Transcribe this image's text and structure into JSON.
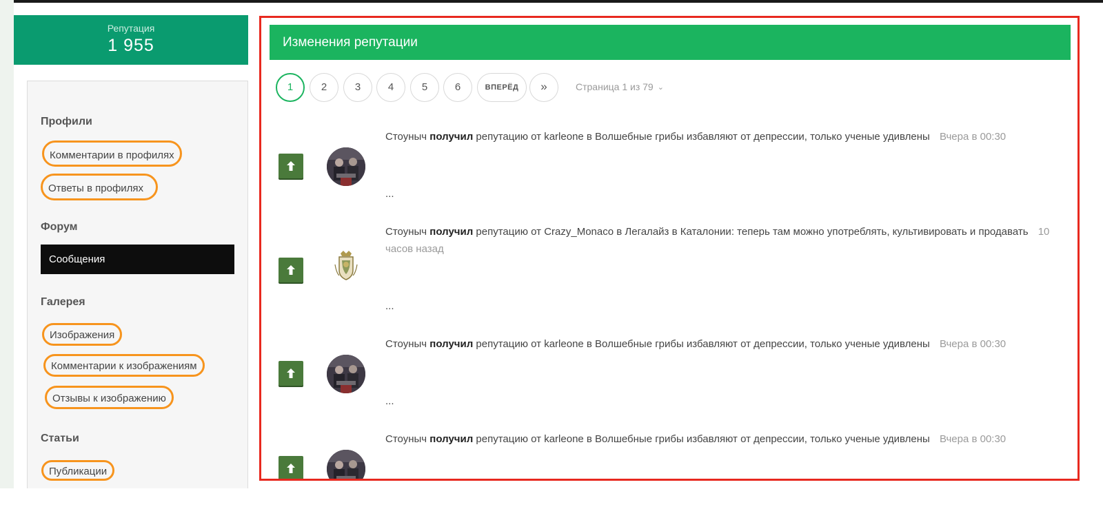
{
  "reputation": {
    "label": "Репутация",
    "value": "1 955"
  },
  "sidebar": {
    "sections": [
      {
        "heading": "Профили"
      },
      {
        "heading": "Форум"
      },
      {
        "heading": "Галерея"
      },
      {
        "heading": "Статьи"
      }
    ],
    "links": {
      "profile_comments": "Комментарии в профилях",
      "profile_replies": "Ответы в профилях",
      "forum_posts": "Сообщения",
      "gallery_images": "Изображения",
      "gallery_image_comments": "Комментарии к изображениям",
      "gallery_image_reviews": "Отзывы к изображению",
      "articles_publications": "Публикации"
    }
  },
  "main": {
    "title": "Изменения репутации",
    "pager": {
      "pages": [
        "1",
        "2",
        "3",
        "4",
        "5",
        "6"
      ],
      "current": "1",
      "next_label": "ВПЕРЁД",
      "last_label": "»",
      "info": "Страница 1 из 79"
    },
    "feed": [
      {
        "user": "Стоуныч",
        "action": "получил",
        "text": "репутацию от karleone в Волшебные грибы избавляют от депрессии, только ученые удивлены",
        "time": "Вчера в 00:30",
        "excerpt": "...",
        "avatar": "avatar-photo"
      },
      {
        "user": "Стоуныч",
        "action": "получил",
        "text": "репутацию от Crazy_Monaco в Легалайз в Каталонии: теперь там можно употреблять, культивировать и продавать",
        "time": "10 часов назад",
        "excerpt": "...",
        "avatar": "monaco-crest"
      },
      {
        "user": "Стоуныч",
        "action": "получил",
        "text": "репутацию от karleone в Волшебные грибы избавляют от депрессии, только ученые удивлены",
        "time": "Вчера в 00:30",
        "excerpt": "...",
        "avatar": "avatar-photo"
      },
      {
        "user": "Стоуныч",
        "action": "получил",
        "text": "репутацию от karleone в Волшебные грибы избавляют от депрессии, только ученые удивлены",
        "time": "Вчера в 00:30",
        "excerpt": "",
        "avatar": "avatar-photo"
      }
    ]
  },
  "colors": {
    "reputation_card": "#0a9b6f",
    "header_green": "#1bb45f",
    "rep_up_button": "#4a7a3b",
    "highlight_frame": "#e8291f",
    "annotation_ring": "#f7941d"
  },
  "icons": {
    "rep_up": "arrow-up-icon",
    "page_info": "chevron-down-icon"
  }
}
